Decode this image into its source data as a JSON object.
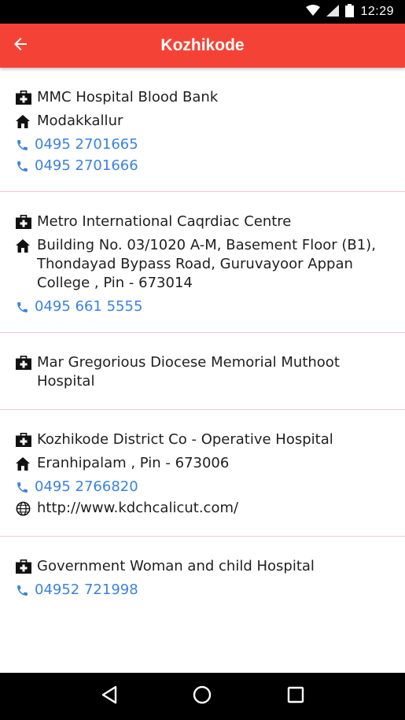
{
  "status_bar": {
    "time": "12:29"
  },
  "app_bar": {
    "title": "Kozhikode"
  },
  "colors": {
    "accent": "#f44336",
    "link": "#3b82e0",
    "divider": "#f6c6d0"
  },
  "hospitals": [
    {
      "name": "MMC Hospital Blood Bank",
      "address": "Modakkallur",
      "phones": [
        "0495 2701665",
        "0495 2701666"
      ]
    },
    {
      "name": "Metro International Caqrdiac Centre",
      "address": "Building No. 03/1020 A-M, Basement Floor (B1), Thondayad Bypass Road, Guruvayoor Appan College , Pin - 673014",
      "phones": [
        "0495 661 5555"
      ]
    },
    {
      "name": "Mar Gregorious Diocese Memorial Muthoot Hospital"
    },
    {
      "name": "Kozhikode District Co - Operative Hospital",
      "address": "Eranhipalam , Pin - 673006",
      "phones": [
        "0495 2766820"
      ],
      "website": "http://www.kdchcalicut.com/"
    },
    {
      "name": "Government Woman and child Hospital",
      "phones": [
        "04952 721998"
      ]
    }
  ],
  "icons": {
    "hospital": "first-aid-kit-icon",
    "address": "home-icon",
    "phone": "phone-icon",
    "website": "globe-icon",
    "back": "arrow-left-icon",
    "nav": [
      "back-triangle-icon",
      "home-circle-icon",
      "recents-square-icon"
    ]
  }
}
